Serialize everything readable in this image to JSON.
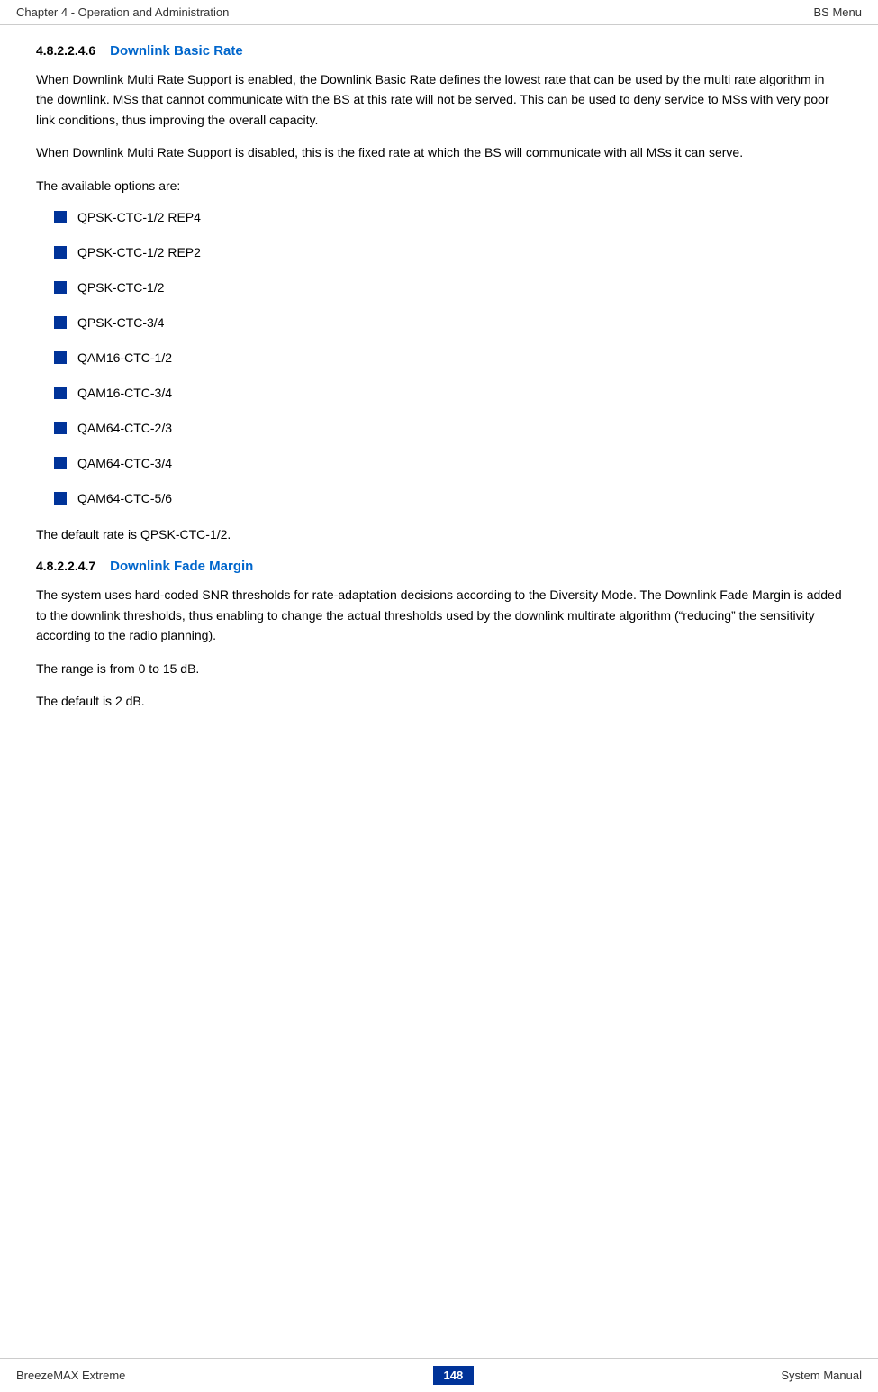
{
  "header": {
    "left": "Chapter 4 - Operation and Administration",
    "right": "BS Menu"
  },
  "footer": {
    "left": "BreezeMAX Extreme",
    "page": "148",
    "right": "System Manual"
  },
  "section1": {
    "number": "4.8.2.2.4.6",
    "title": "Downlink Basic Rate",
    "para1": "When Downlink Multi Rate Support is enabled, the Downlink Basic Rate defines the lowest rate that can be used by the multi rate algorithm in the downlink. MSs that cannot communicate with the BS at this rate will not be served. This can be used to deny service to MSs with very poor link conditions, thus improving the overall capacity.",
    "para2": "When Downlink Multi Rate Support is disabled, this is the fixed rate at which the BS will communicate with all MSs it can serve.",
    "para3": "The available options are:",
    "bullets": [
      "QPSK-CTC-1/2 REP4",
      "QPSK-CTC-1/2 REP2",
      "QPSK-CTC-1/2",
      "QPSK-CTC-3/4",
      "QAM16-CTC-1/2",
      "QAM16-CTC-3/4",
      "QAM64-CTC-2/3",
      "QAM64-CTC-3/4",
      "QAM64-CTC-5/6"
    ],
    "default_note": "The default rate is QPSK-CTC-1/2."
  },
  "section2": {
    "number": "4.8.2.2.4.7",
    "title": "Downlink Fade Margin",
    "para1": "The system uses hard-coded SNR thresholds for rate-adaptation decisions according to the Diversity Mode. The Downlink Fade Margin is added to the downlink thresholds, thus enabling to change the actual thresholds used by the downlink multirate algorithm (“reducing” the sensitivity according to the radio planning).",
    "para2": "The range is from 0 to 15 dB.",
    "para3": "The default is 2 dB."
  }
}
